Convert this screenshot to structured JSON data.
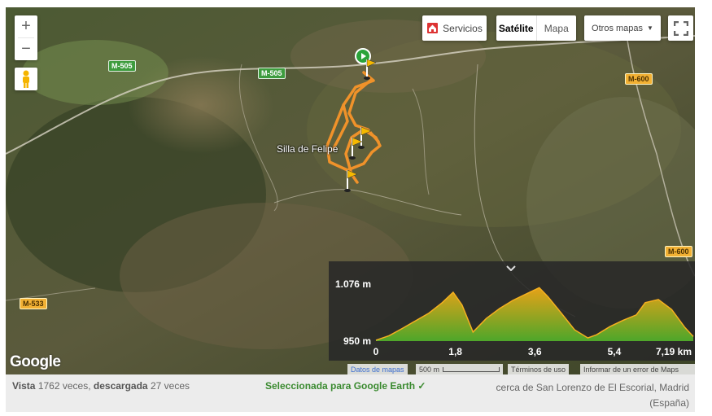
{
  "map": {
    "buttons": {
      "services": "Servicios",
      "satellite": "Satélite",
      "map": "Mapa",
      "other_maps": "Otros mapas"
    },
    "zoom": {
      "in": "+",
      "out": "−"
    },
    "roads": [
      "M-505",
      "M-505",
      "M-600",
      "M-600",
      "M-533"
    ],
    "place_label": "Silla de Felipe",
    "logo": "Google",
    "attribution": {
      "map_data": "Datos de mapas",
      "scale": "500 m",
      "terms": "Términos de uso",
      "report": "Informar de un error de Maps"
    }
  },
  "chart_data": {
    "type": "area",
    "title": "",
    "xlabel": "",
    "ylabel": "",
    "y_tick_labels": [
      "1.076 m",
      "950 m"
    ],
    "x_tick_labels": [
      "0",
      "1,8",
      "3,6",
      "5,4",
      "7,19 km"
    ],
    "xlim": [
      0,
      7.19
    ],
    "ylim": [
      950,
      1076
    ],
    "x": [
      0,
      0.3,
      0.6,
      0.9,
      1.2,
      1.5,
      1.75,
      1.95,
      2.2,
      2.5,
      2.8,
      3.1,
      3.4,
      3.7,
      3.9,
      4.2,
      4.5,
      4.8,
      5.0,
      5.3,
      5.6,
      5.9,
      6.1,
      6.4,
      6.7,
      7.0,
      7.19
    ],
    "y": [
      952,
      962,
      978,
      995,
      1012,
      1035,
      1058,
      1030,
      970,
      1000,
      1022,
      1040,
      1054,
      1068,
      1048,
      1012,
      975,
      957,
      964,
      982,
      996,
      1008,
      1035,
      1042,
      1020,
      980,
      960
    ]
  },
  "footer": {
    "views_label": "Vista",
    "views_count": "1762",
    "views_suffix": "veces,",
    "downloads_label": "descargada",
    "downloads_count": "27",
    "downloads_suffix": "veces",
    "google_earth": "Seleccionada para Google Earth",
    "google_earth_check": "✓",
    "location": "cerca de San Lorenzo de El Escorial, Madrid",
    "country": "(España)"
  },
  "colors": {
    "track": "#f0922a",
    "elevation_fill_top": "#e6a218",
    "elevation_fill_bottom": "#4ea62a",
    "green_text": "#3a8a2f"
  }
}
